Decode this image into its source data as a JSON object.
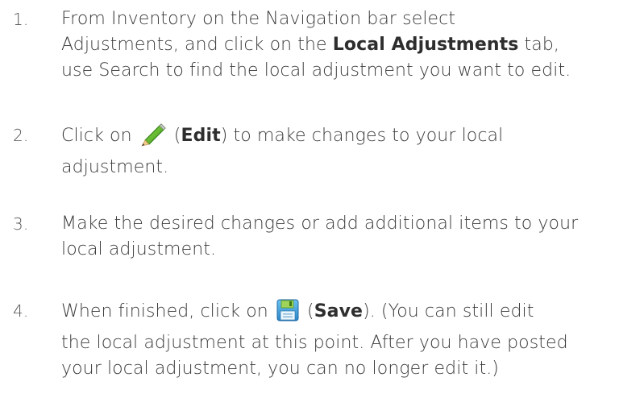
{
  "steps": [
    {
      "number": "1.",
      "line1": "From Inventory on the Navigation bar select",
      "line2_prefix": "Adjustments, and click on the ",
      "line2_bold": "Local Adjustments",
      "line2_suffix": " tab,",
      "line3": "use Search to find the local adjustment you want to edit."
    },
    {
      "number": "2.",
      "line1_prefix": "Click on ",
      "icon": "edit-pencil-icon",
      "line1_paren_open": " (",
      "line1_bold": "Edit",
      "line1_suffix": ") to make changes to your local",
      "line2": "adjustment."
    },
    {
      "number": "3.",
      "line1": "Make the desired changes or add additional items to your",
      "line2": "local adjustment."
    },
    {
      "number": "4.",
      "line1_prefix": "When finished, click on ",
      "icon": "save-floppy-icon",
      "line1_paren_open": " (",
      "line1_bold": "Save",
      "line1_suffix": "). (You can still edit",
      "line2": "the local adjustment at this point.  After you have posted",
      "line3": "your local adjustment, you can no longer edit it.)"
    }
  ],
  "colors": {
    "text": "#3a3a3a",
    "pencil_green": "#6bbf2e",
    "floppy_blue": "#4aa8e0",
    "floppy_label": "#9fd35a"
  }
}
